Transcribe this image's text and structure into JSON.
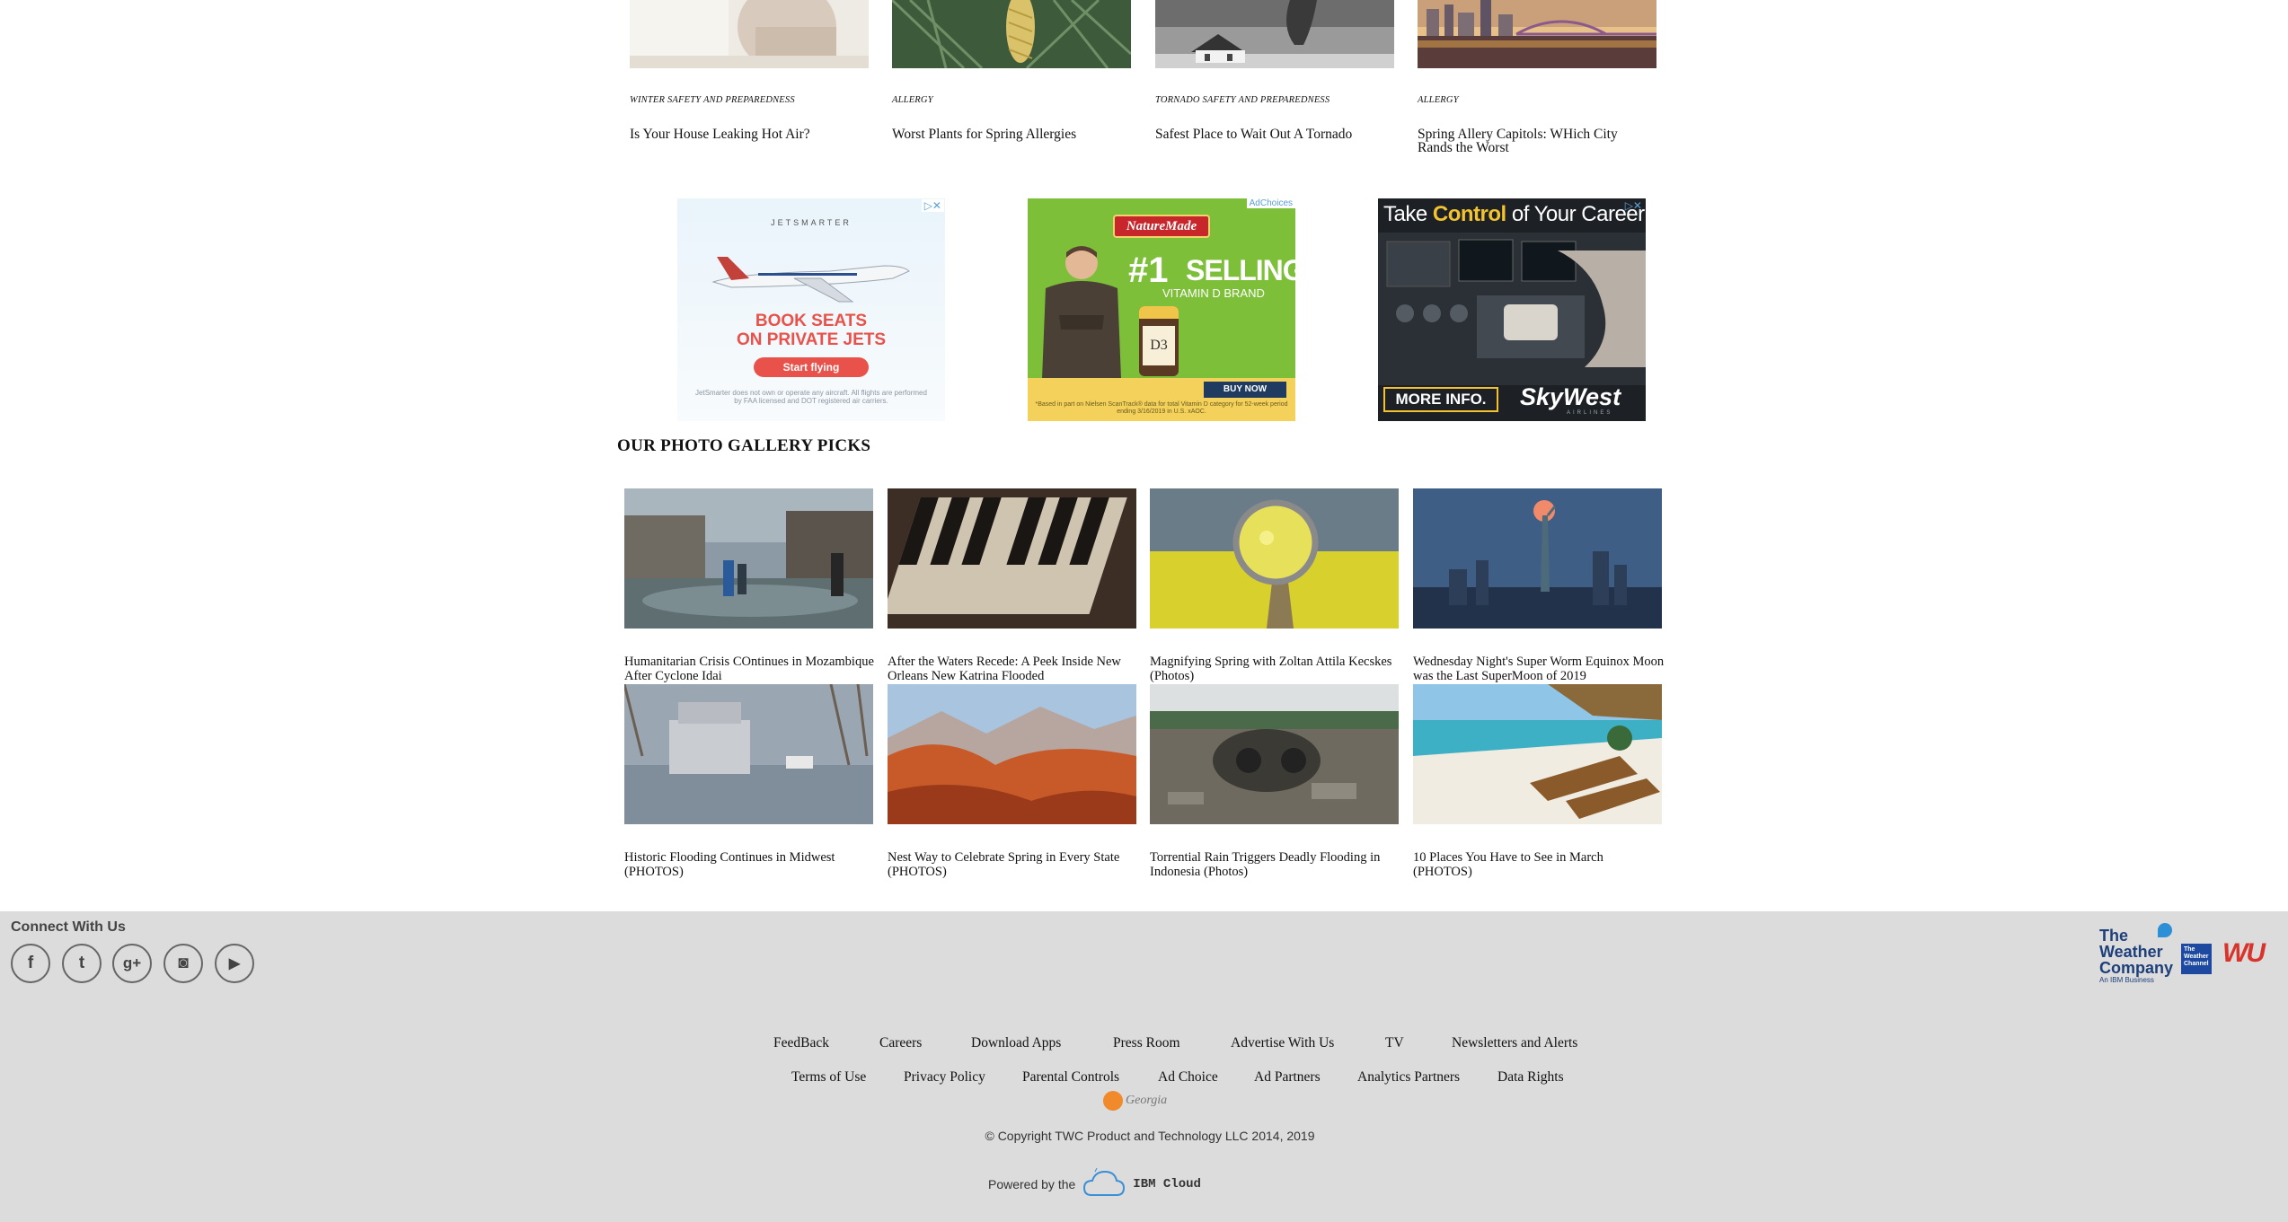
{
  "top_articles": [
    {
      "category": "WINTER SAFETY AND PREPAREDNESS",
      "title": "Is Your House Leaking Hot Air?"
    },
    {
      "category": "ALLERGY",
      "title": "Worst Plants for Spring Allergies"
    },
    {
      "category": "TORNADO SAFETY AND PREPAREDNESS",
      "title": "Safest Place to Wait Out A Tornado"
    },
    {
      "category": "ALLERGY",
      "title": "Spring Allery Capitols: WHich City Rands the Worst"
    }
  ],
  "ads": {
    "jetsmarter": {
      "brand": "JETSMARTER",
      "headline_1": "BOOK SEATS",
      "headline_2": "ON PRIVATE JETS",
      "cta": "Start flying",
      "disclaimer": "JetSmarter does not own or operate any aircraft. All flights are performed by FAA licensed and DOT registered air carriers."
    },
    "naturemade": {
      "adchoices": "AdChoices",
      "brand": "NatureMade",
      "rank": "#1",
      "line_1": "SELLING",
      "line_2": "VITAMIN D BRAND",
      "bottle_label": "D3",
      "cta": "BUY NOW",
      "footnote": "*Based in part on Nielsen ScanTrack® data for total Vitamin D category for 52-week period ending 3/16/2019 in U.S. xAOC."
    },
    "skywest": {
      "headline_1": "Take ",
      "headline_2": "Control",
      "headline_3": " of Your Career",
      "cta": "MORE INFO.",
      "brand": "SkyWest",
      "brand_sub": "AIRLINES"
    }
  },
  "gallery": {
    "title": "OUR PHOTO GALLERY PICKS",
    "items": [
      {
        "caption": "Humanitarian Crisis COntinues in Mozambique After Cyclone Idai"
      },
      {
        "caption": "After the Waters Recede: A Peek Inside New Orleans New Katrina Flooded"
      },
      {
        "caption": "Magnifying Spring with Zoltan Attila Kecskes (Photos)"
      },
      {
        "caption": "Wednesday Night's Super Worm Equinox Moon was the Last SuperMoon of 2019"
      },
      {
        "caption": "Historic Flooding Continues in Midwest (PHOTOS)"
      },
      {
        "caption": "Nest Way to Celebrate Spring in Every State (PHOTOS)"
      },
      {
        "caption": "Torrential Rain Triggers Deadly Flooding in Indonesia (Photos)"
      },
      {
        "caption": "10 Places You Have to See in March (PHOTOS)"
      }
    ]
  },
  "footer": {
    "connect_label": "Connect With Us",
    "social": [
      {
        "icon": "facebook-icon",
        "glyph": "f"
      },
      {
        "icon": "twitter-icon",
        "glyph": "t"
      },
      {
        "icon": "google-plus-icon",
        "glyph": "g+"
      },
      {
        "icon": "instagram-icon",
        "glyph": "◙"
      },
      {
        "icon": "youtube-icon",
        "glyph": "▶"
      }
    ],
    "links_row1": [
      "FeedBack",
      "Careers",
      "Download Apps",
      "Press Room",
      "Advertise With Us",
      "TV",
      "Newsletters and Alerts"
    ],
    "links_row2": [
      "Terms of Use",
      "Privacy Policy",
      "Parental Controls",
      "Ad Choice",
      "Ad Partners",
      "Analytics Partners",
      "Data Rights"
    ],
    "georgia_label": "Georgia",
    "copyright": "© Copyright TWC Product and Technology LLC 2014, 2019",
    "powered_by": "Powered by the",
    "ibm_cloud": "IBM Cloud",
    "logos": {
      "twc_1": "The",
      "twc_2": "Weather",
      "twc_3": "Company",
      "twc_sub": "An IBM Business",
      "channel": "The Weather Channel",
      "wu": "WU"
    }
  }
}
